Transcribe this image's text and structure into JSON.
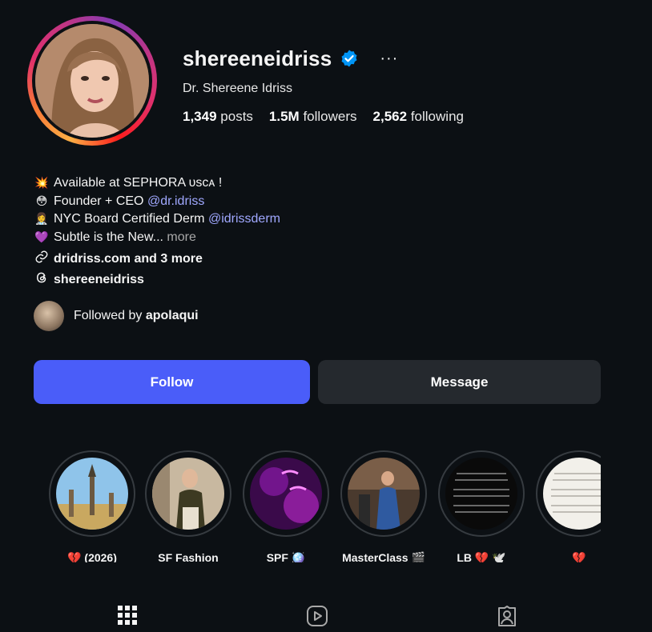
{
  "profile": {
    "username": "shereeneidriss",
    "full_name": "Dr. Shereene Idriss",
    "more_options": "···",
    "stats": {
      "posts_count": "1,349",
      "posts_label": "posts",
      "followers_count": "1.5M",
      "followers_label": "followers",
      "following_count": "2,562",
      "following_label": "following"
    }
  },
  "bio": {
    "line1": {
      "emoji": "💥",
      "text": "Available at SEPHORA ᴜsᴄᴀ !"
    },
    "line2": {
      "emoji": "😳",
      "text": "Founder + CEO ",
      "mention": "@dr.idriss"
    },
    "line3": {
      "emoji": "👩‍⚕️",
      "text": "NYC Board Certified Derm ",
      "mention": "@idrissderm"
    },
    "line4": {
      "emoji": "💜",
      "text": "Subtle is the New... ",
      "more": "more"
    }
  },
  "links": {
    "website": "dridriss.com and 3 more",
    "threads": "shereeneidriss"
  },
  "followed_by": {
    "prefix": "Followed by ",
    "user": "apolaqui"
  },
  "actions": {
    "follow": "Follow",
    "message": "Message"
  },
  "highlights": [
    {
      "label": "💔 (2026)"
    },
    {
      "label": "SF Fashion"
    },
    {
      "label": "SPF 🪩"
    },
    {
      "label": "MasterClass 🎬"
    },
    {
      "label": "LB 💔 🕊️"
    },
    {
      "label": "💔"
    }
  ],
  "tabs": [
    {
      "icon": "grid-icon"
    },
    {
      "icon": "reels-icon"
    },
    {
      "icon": "tagged-icon"
    }
  ],
  "colors": {
    "background": "#0c1014",
    "follow_button": "#4a5df9",
    "message_button": "#25292e",
    "mention": "#a0a8ff",
    "verified": "#0095f6"
  }
}
